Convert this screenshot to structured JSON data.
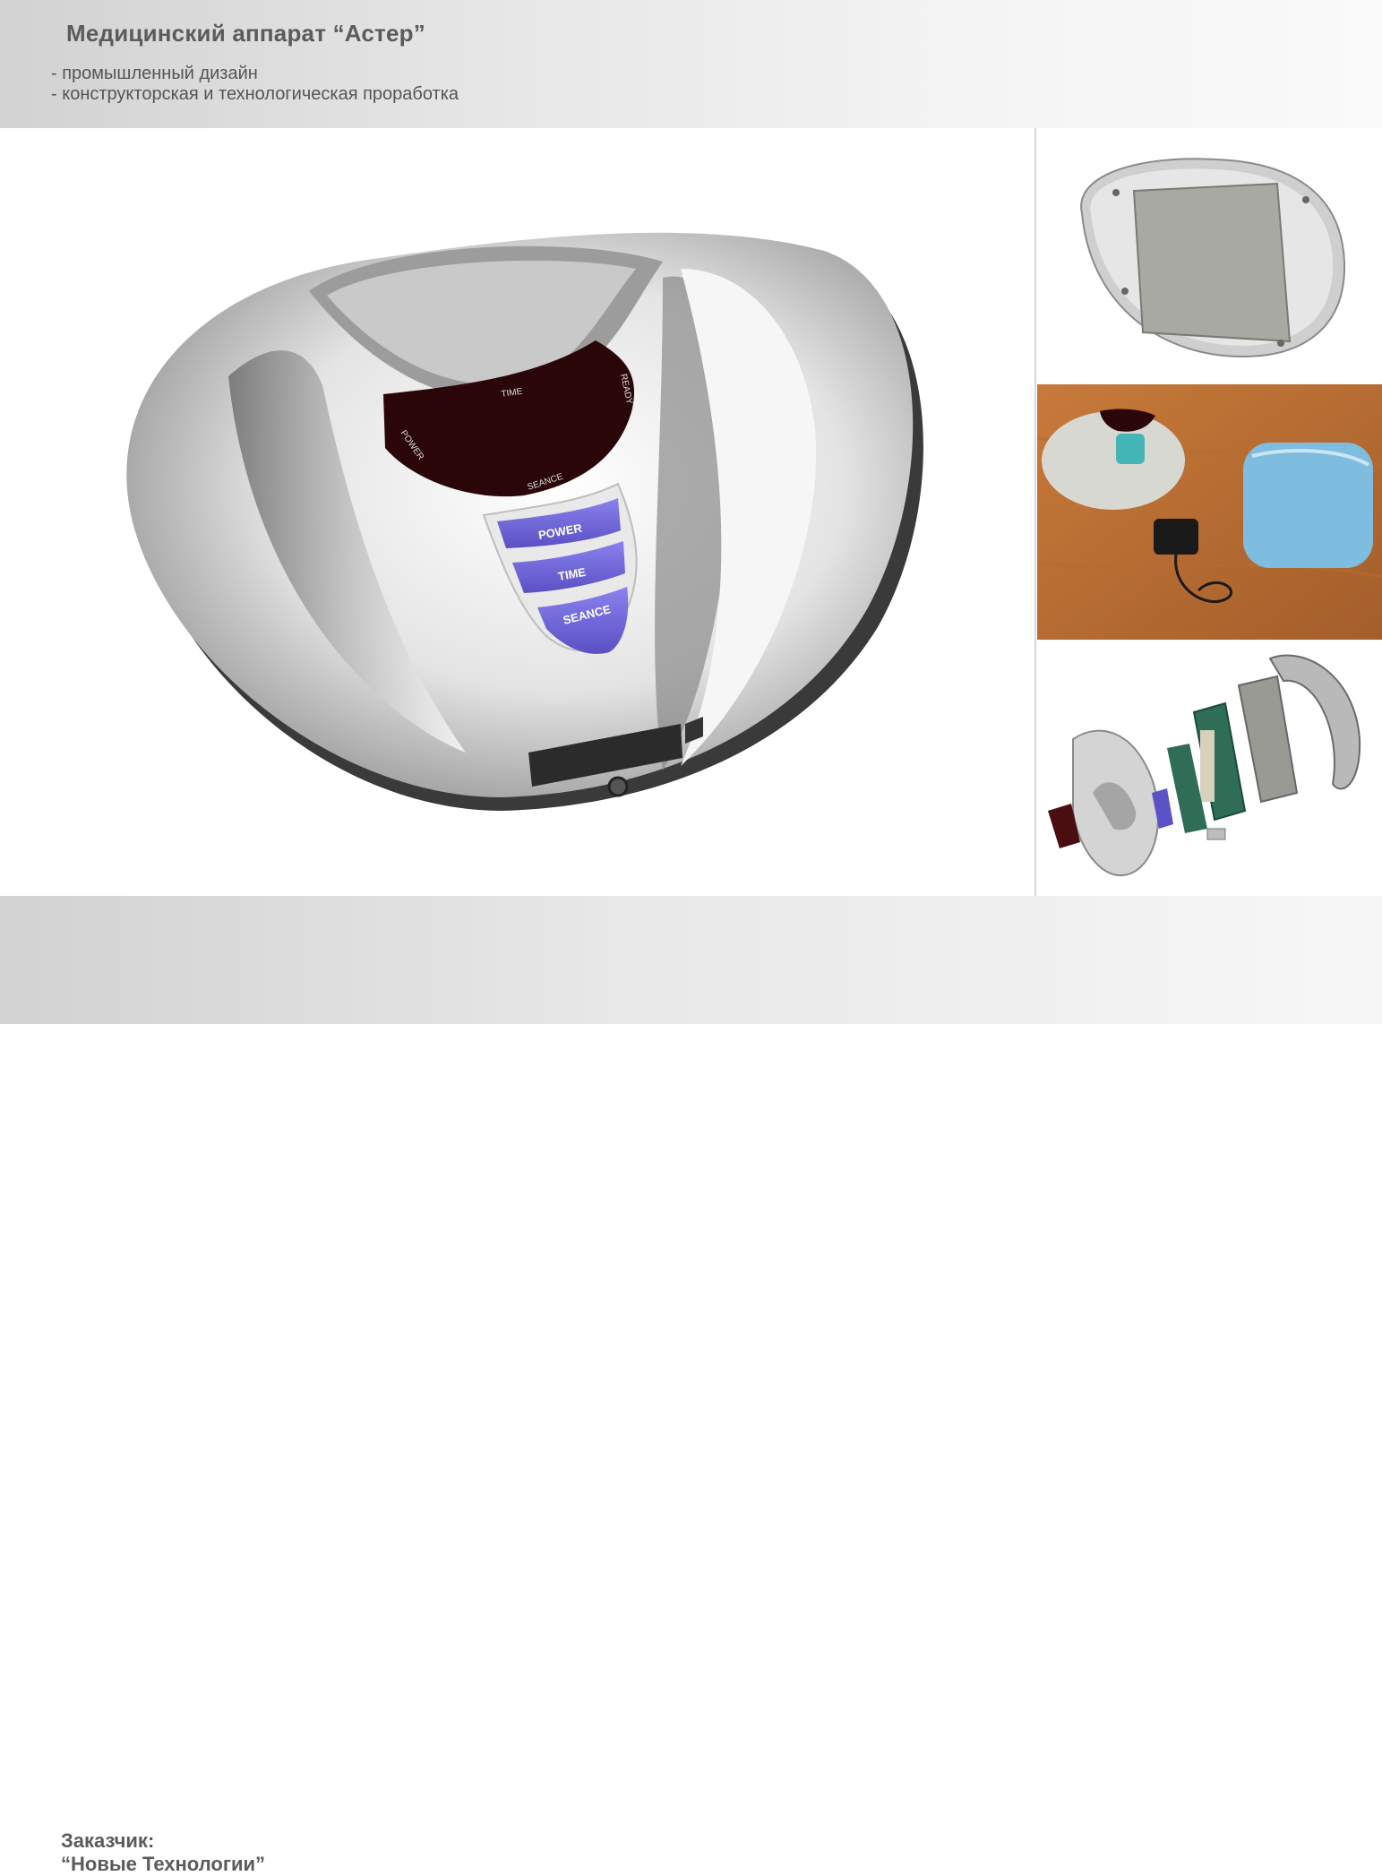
{
  "header": {
    "title": "Медицинский аппарат “Астер”",
    "bullets": [
      "- промышленный дизайн",
      "- конструкторская и технологическая проработка"
    ]
  },
  "device": {
    "display_labels": {
      "power": "POWER",
      "time": "TIME",
      "ready": "READY",
      "seance": "SEANCE"
    },
    "buttons": [
      "POWER",
      "TIME",
      "SEANCE"
    ],
    "colors": {
      "body": "#d8d8d8",
      "display": "#2a0608",
      "buttons": "#6c62d8"
    }
  },
  "footer": {
    "client_label": "Заказчик:",
    "client_name": "“Новые Технологии”"
  }
}
